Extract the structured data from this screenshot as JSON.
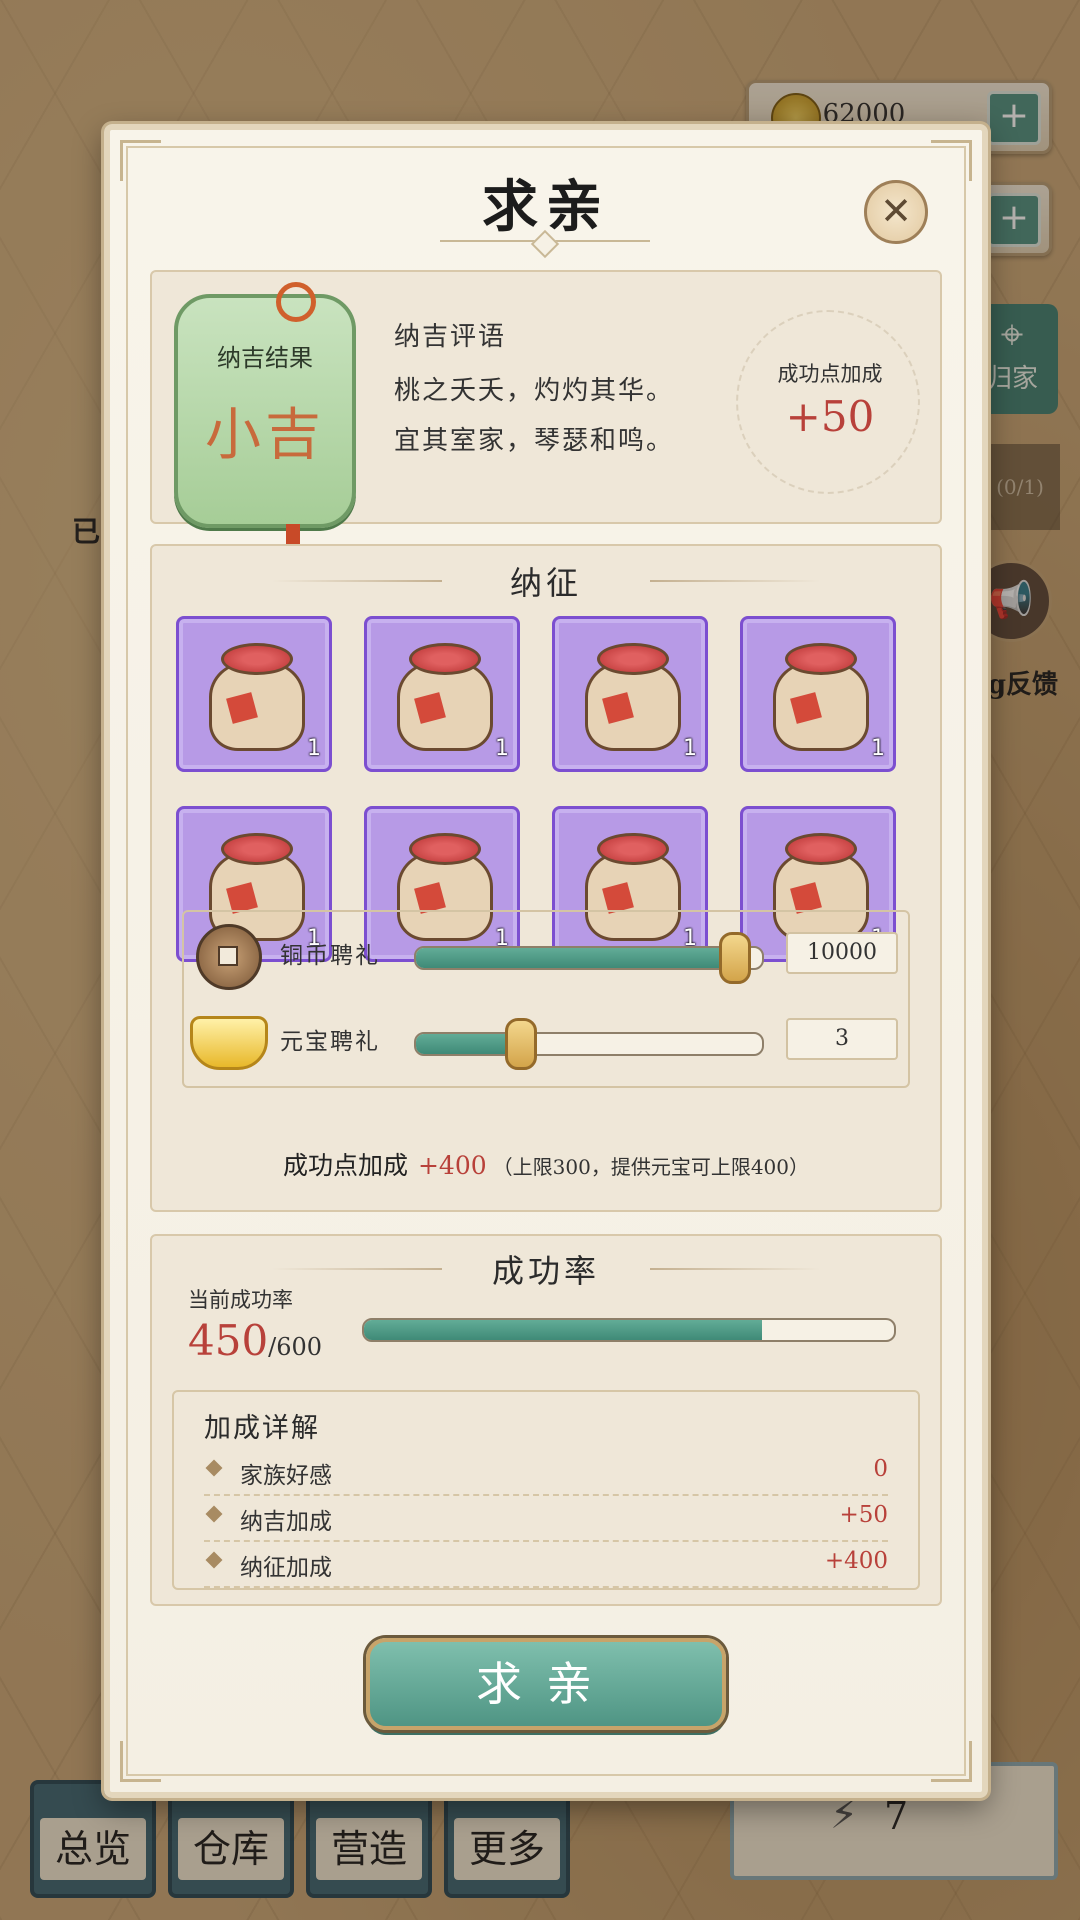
{
  "hud": {
    "coins": "62000",
    "coin_plus_label": "+",
    "second_plus_label": "+",
    "location_label": "归家",
    "quest_count": "(0/1)",
    "feedback_label": "bug反馈",
    "left_label_partial": "已"
  },
  "bottom_nav": {
    "items": [
      {
        "label": "总览"
      },
      {
        "label": "仓库"
      },
      {
        "label": "营造"
      },
      {
        "label": "更多"
      }
    ],
    "energy": "7"
  },
  "dialog": {
    "title": "求亲",
    "close_icon": "close-icon",
    "naji": {
      "tag_label": "纳吉结果",
      "result": "小吉",
      "comment_title": "纳吉评语",
      "comment_lines": [
        "桃之夭夭，灼灼其华。",
        "宜其室家，琴瑟和鸣。"
      ],
      "bonus_label": "成功点加成",
      "bonus_value": "+50"
    },
    "nazheng": {
      "title": "纳征",
      "slots": [
        {
          "item": "betrothal-gift-bag",
          "count": "1"
        },
        {
          "item": "betrothal-gift-bag",
          "count": "1"
        },
        {
          "item": "betrothal-gift-bag",
          "count": "1"
        },
        {
          "item": "betrothal-gift-bag",
          "count": "1"
        },
        {
          "item": "betrothal-gift-bag",
          "count": "1"
        },
        {
          "item": "betrothal-gift-bag",
          "count": "1"
        },
        {
          "item": "betrothal-gift-bag",
          "count": "1"
        },
        {
          "item": "betrothal-gift-bag",
          "count": "1"
        }
      ],
      "copper": {
        "label": "铜币聘礼",
        "value": "10000",
        "slider_fraction": 0.92
      },
      "ingot": {
        "label": "元宝聘礼",
        "value": "3",
        "slider_fraction": 0.3
      },
      "summary_label": "成功点加成",
      "summary_value": "+400",
      "summary_note": "（上限300，提供元宝可上限400）"
    },
    "success": {
      "title": "成功率",
      "current_label": "当前成功率",
      "current_value": "450",
      "max_value": "/600",
      "fraction": 0.75,
      "detail_title": "加成详解",
      "details": [
        {
          "label": "家族好感",
          "value": "0"
        },
        {
          "label": "纳吉加成",
          "value": "+50"
        },
        {
          "label": "纳征加成",
          "value": "+400"
        }
      ]
    },
    "action_label": "求亲",
    "colors": {
      "accent_red": "#b8413a",
      "slot_purple": "#b79ae6",
      "teal": "#4f9584"
    }
  }
}
